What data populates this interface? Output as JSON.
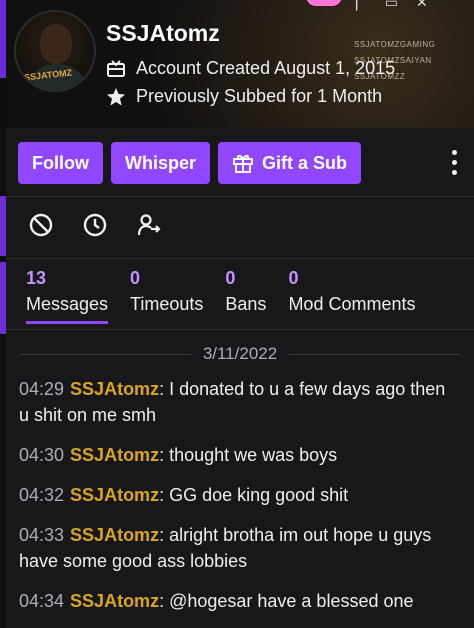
{
  "profile": {
    "username": "SSJAtomz",
    "account_created": "Account Created August 1, 2015",
    "subbed": "Previously Subbed for 1 Month",
    "avatar_tag": "SSJATOMZ",
    "banner_watermark": [
      "SSJATOMZGAMING",
      "SSJATOMZSAIYAN",
      "SSJATOMZZ"
    ]
  },
  "actions": {
    "follow": "Follow",
    "whisper": "Whisper",
    "gift": "Gift a Sub"
  },
  "mod_icons": [
    "ban-icon",
    "timeout-clock-icon",
    "user-arrow-icon"
  ],
  "stats": [
    {
      "count": "13",
      "label": "Messages"
    },
    {
      "count": "0",
      "label": "Timeouts"
    },
    {
      "count": "0",
      "label": "Bans"
    },
    {
      "count": "0",
      "label": "Mod Comments"
    }
  ],
  "date": "3/11/2022",
  "messages": [
    {
      "time": "04:29",
      "user": "SSJAtomz",
      "text": ": I donated to u a few days ago then u shit on me smh"
    },
    {
      "time": "04:30",
      "user": "SSJAtomz",
      "text": ": thought we was boys"
    },
    {
      "time": "04:32",
      "user": "SSJAtomz",
      "text": ": GG doe king good shit"
    },
    {
      "time": "04:33",
      "user": "SSJAtomz",
      "text": ": alright brotha im out hope u guys have some good ass lobbies"
    },
    {
      "time": "04:34",
      "user": "SSJAtomz",
      "text": ": @hogesar have a blessed one"
    }
  ],
  "colors": {
    "accent": "#9147ff",
    "username": "#daa520",
    "count": "#bf94ff"
  }
}
